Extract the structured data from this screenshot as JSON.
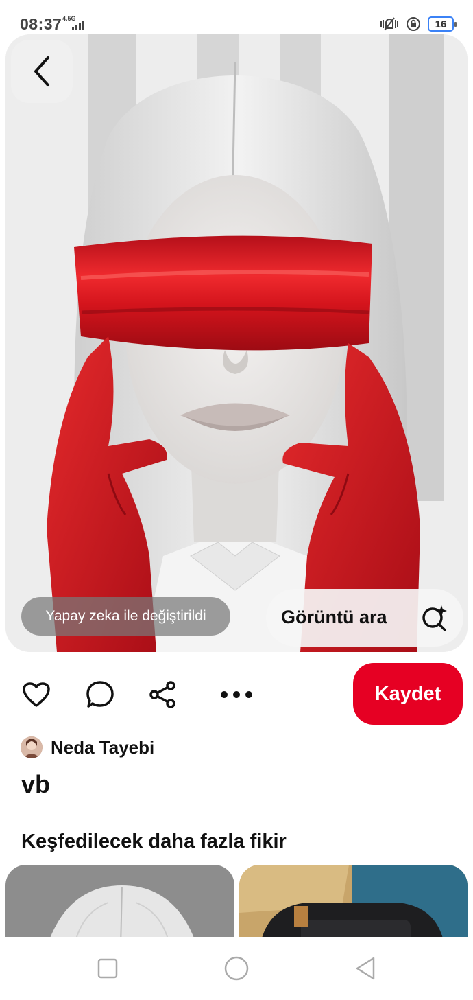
{
  "status_bar": {
    "time": "08:37",
    "network": "4.5G",
    "battery": "16"
  },
  "pin": {
    "ai_badge": "Yapay zeka ile değiştirildi",
    "visual_search_label": "Görüntü ara",
    "save_label": "Kaydet",
    "author_name": "Neda Tayebi",
    "title": "vb"
  },
  "more_ideas": {
    "heading": "Keşfedilecek daha fazla fikir"
  },
  "colors": {
    "brand_red": "#e60023",
    "blindfold_red": "#d8161b"
  },
  "icons": [
    "back-icon",
    "heart-icon",
    "comment-icon",
    "share-icon",
    "more-icon",
    "visual-search-icon",
    "square-nav-icon",
    "circle-nav-icon",
    "triangle-nav-icon"
  ]
}
